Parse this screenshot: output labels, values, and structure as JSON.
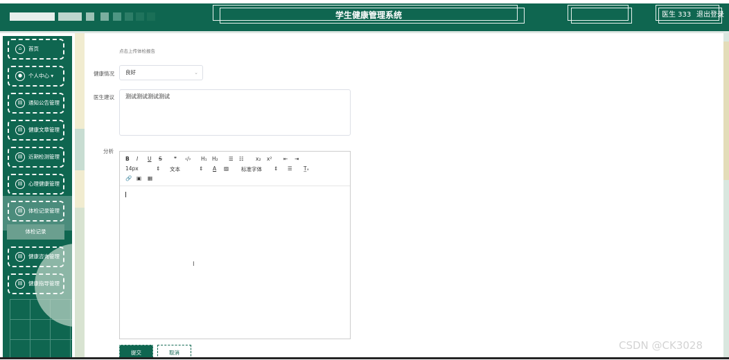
{
  "header": {
    "title": "学生健康管理系统",
    "user": "医生 333",
    "logout": "退出登录"
  },
  "sidebar": {
    "items": [
      {
        "label": "首页",
        "icon": "home-icon"
      },
      {
        "label": "个人中心 ▾",
        "icon": "user-icon"
      },
      {
        "label": "通知公告管理",
        "icon": "bag-icon"
      },
      {
        "label": "健康文章管理",
        "icon": "bag-icon"
      },
      {
        "label": "近期检测管理",
        "icon": "bag-icon"
      },
      {
        "label": "心理健康管理",
        "icon": "bag-icon"
      },
      {
        "label": "体检记录管理",
        "icon": "bag-icon"
      },
      {
        "label": "健康咨询管理",
        "icon": "bag-icon"
      },
      {
        "label": "健康指导管理",
        "icon": "bag-icon"
      }
    ],
    "submenu": "体检记录"
  },
  "form": {
    "hint": "点击上传体检报告",
    "health_label": "健康情况",
    "health_value": "良好",
    "advice_label": "医生建议",
    "advice_value": "测试测试测试测试",
    "analysis_label": "分析"
  },
  "editor": {
    "row1": [
      "B",
      "I",
      "U",
      "S",
      "❞",
      "‹/›",
      "H₁",
      "H₂",
      "☰",
      "☷",
      "x₂",
      "x²",
      "⇤",
      "⇥"
    ],
    "font_size": "14px",
    "text_type": "文本",
    "font_family": "标准字体",
    "color_a": "A",
    "align": "☰",
    "clear": "T̲ₓ"
  },
  "buttons": {
    "submit": "提交",
    "cancel": "取消"
  },
  "watermark": "CSDN @CK3028"
}
